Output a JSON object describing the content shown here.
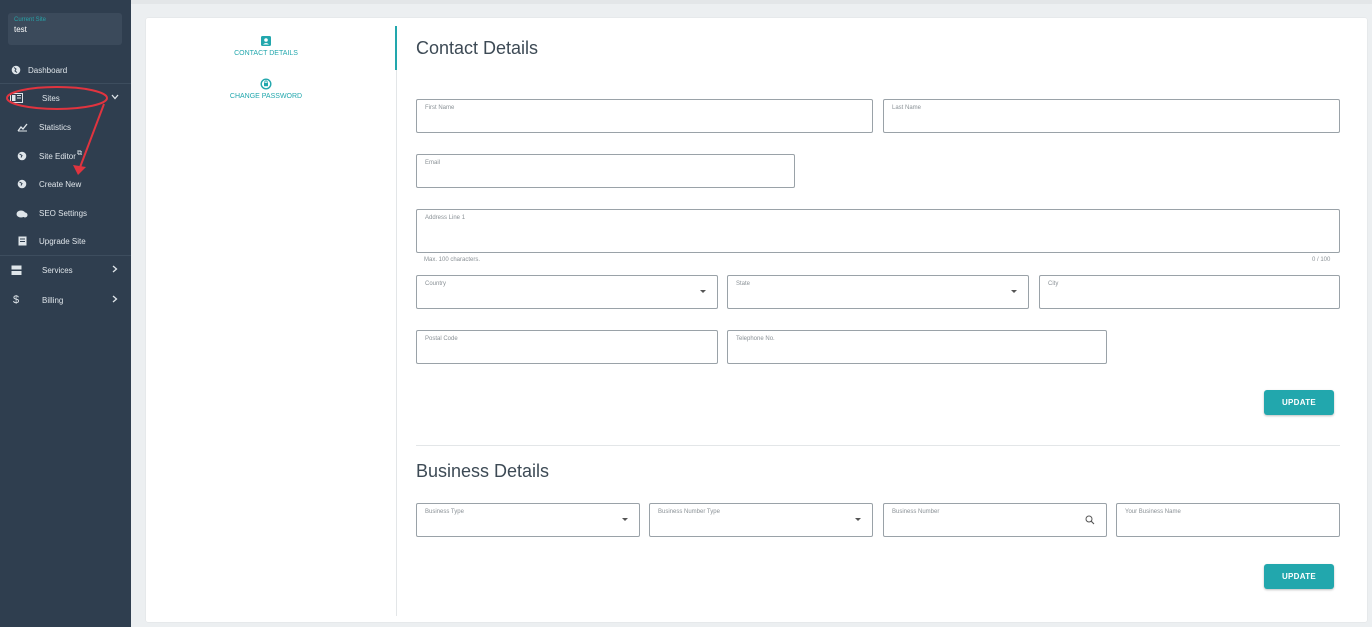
{
  "sidebar": {
    "current_site_label": "Current Site",
    "current_site_value": "test",
    "items": [
      {
        "label": "Dashboard",
        "icon": "globe-icon"
      },
      {
        "label": "Sites",
        "icon": "sites-icon"
      },
      {
        "label": "Statistics",
        "icon": "statistics-icon"
      },
      {
        "label": "Site Editor",
        "icon": "site-editor-icon",
        "suffix": "⧉"
      },
      {
        "label": "Create New",
        "icon": "create-globe-icon"
      },
      {
        "label": "SEO Settings",
        "icon": "seo-icon"
      },
      {
        "label": "Upgrade Site",
        "icon": "upgrade-icon"
      },
      {
        "label": "Services",
        "icon": "services-icon"
      },
      {
        "label": "Billing",
        "icon": "dollar-icon"
      }
    ],
    "annotation_color": "#e0343f"
  },
  "tabs": {
    "contact": "CONTACT DETAILS",
    "password": "CHANGE PASSWORD"
  },
  "contact": {
    "title": "Contact Details",
    "first_name": "First Name",
    "last_name": "Last Name",
    "email": "Email",
    "address1": "Address Line 1",
    "address_hint": "Max. 100 characters.",
    "address_counter": "0 / 100",
    "country": "Country",
    "state": "State",
    "city": "City",
    "postal": "Postal Code",
    "telephone": "Telephone No.",
    "update": "UPDATE"
  },
  "business": {
    "title": "Business Details",
    "type": "Business Type",
    "number_type": "Business Number Type",
    "number": "Business Number",
    "name": "Your Business Name",
    "update": "UPDATE"
  },
  "colors": {
    "accent": "#22a7ad",
    "sidebar": "#2f3e4f"
  }
}
